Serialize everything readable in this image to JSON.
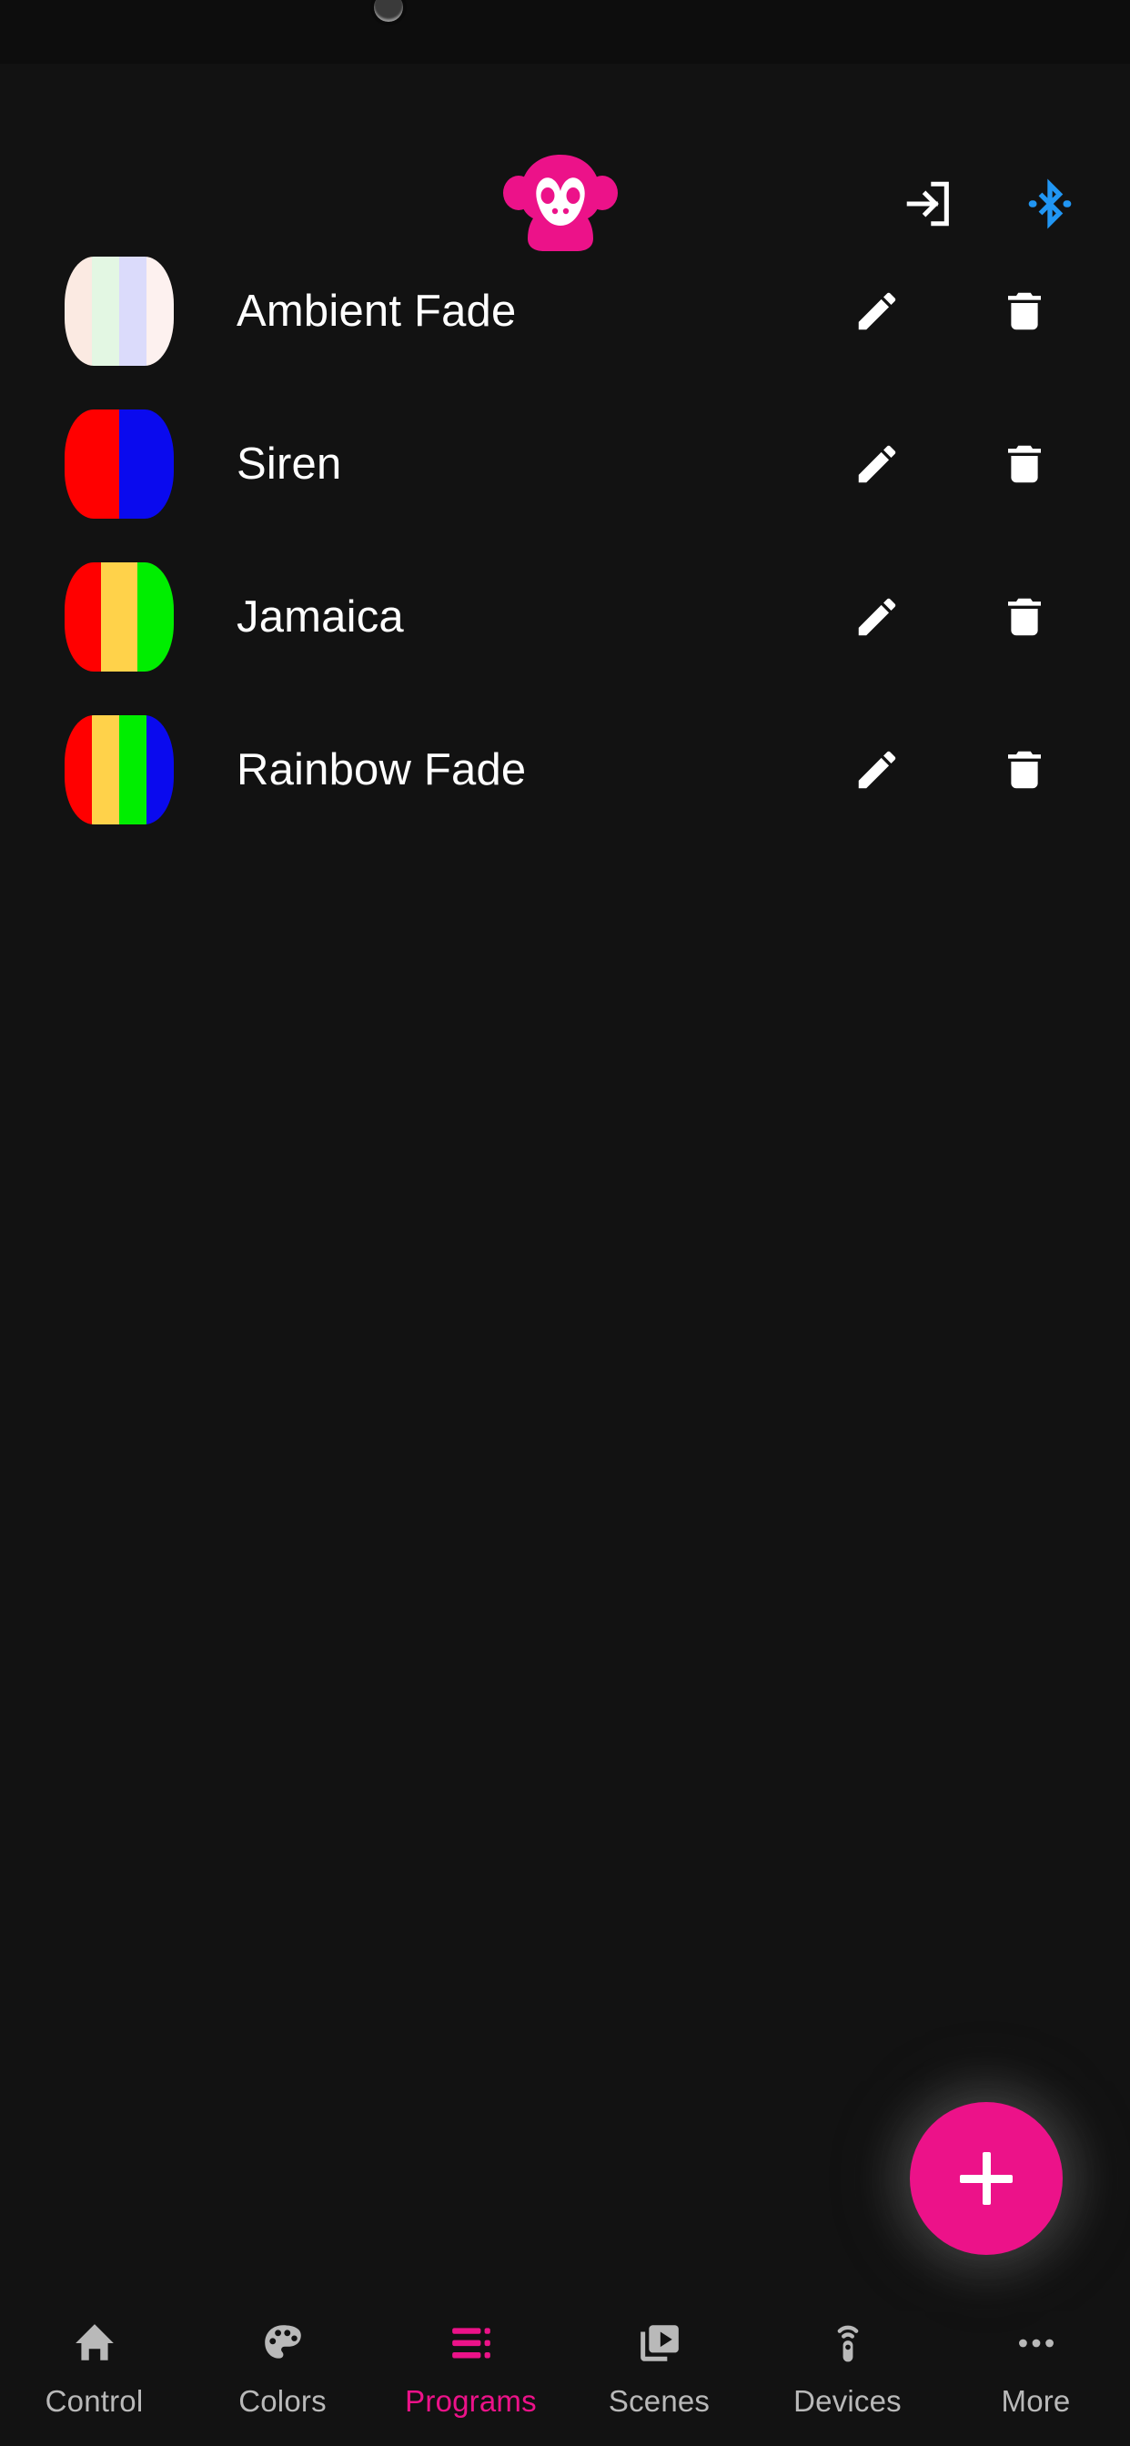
{
  "app": {
    "accent_color": "#ec1289",
    "background_color": "#121212",
    "logo_name": "monkey-logo"
  },
  "header": {
    "login_icon": "login-arrow-icon",
    "login_color": "#ffffff",
    "bluetooth_icon": "bluetooth-icon",
    "bluetooth_color": "#2196f3"
  },
  "programs": {
    "edit_icon": "pencil-icon",
    "delete_icon": "trash-icon",
    "items": [
      {
        "label": "Ambient Fade",
        "colors": [
          "#fbeae2",
          "#e3f7e3",
          "#dbdbfb",
          "#fdf1ef"
        ]
      },
      {
        "label": "Siren",
        "colors": [
          "#ff0000",
          "#0a0aee"
        ]
      },
      {
        "label": "Jamaica",
        "colors": [
          "#ff0000",
          "#ffd24a",
          "#00ee00"
        ]
      },
      {
        "label": "Rainbow Fade",
        "colors": [
          "#ff0000",
          "#ffd24a",
          "#00ee00",
          "#0a0aee"
        ]
      }
    ]
  },
  "fab": {
    "label": "+",
    "name": "add-program-button",
    "color": "#ec1289"
  },
  "bottom_nav": {
    "active": "Programs",
    "items": [
      {
        "label": "Control",
        "icon": "home-icon"
      },
      {
        "label": "Colors",
        "icon": "palette-icon"
      },
      {
        "label": "Programs",
        "icon": "playlist-icon"
      },
      {
        "label": "Scenes",
        "icon": "video-library-icon"
      },
      {
        "label": "Devices",
        "icon": "remote-signal-icon"
      },
      {
        "label": "More",
        "icon": "more-dots-icon"
      }
    ]
  }
}
